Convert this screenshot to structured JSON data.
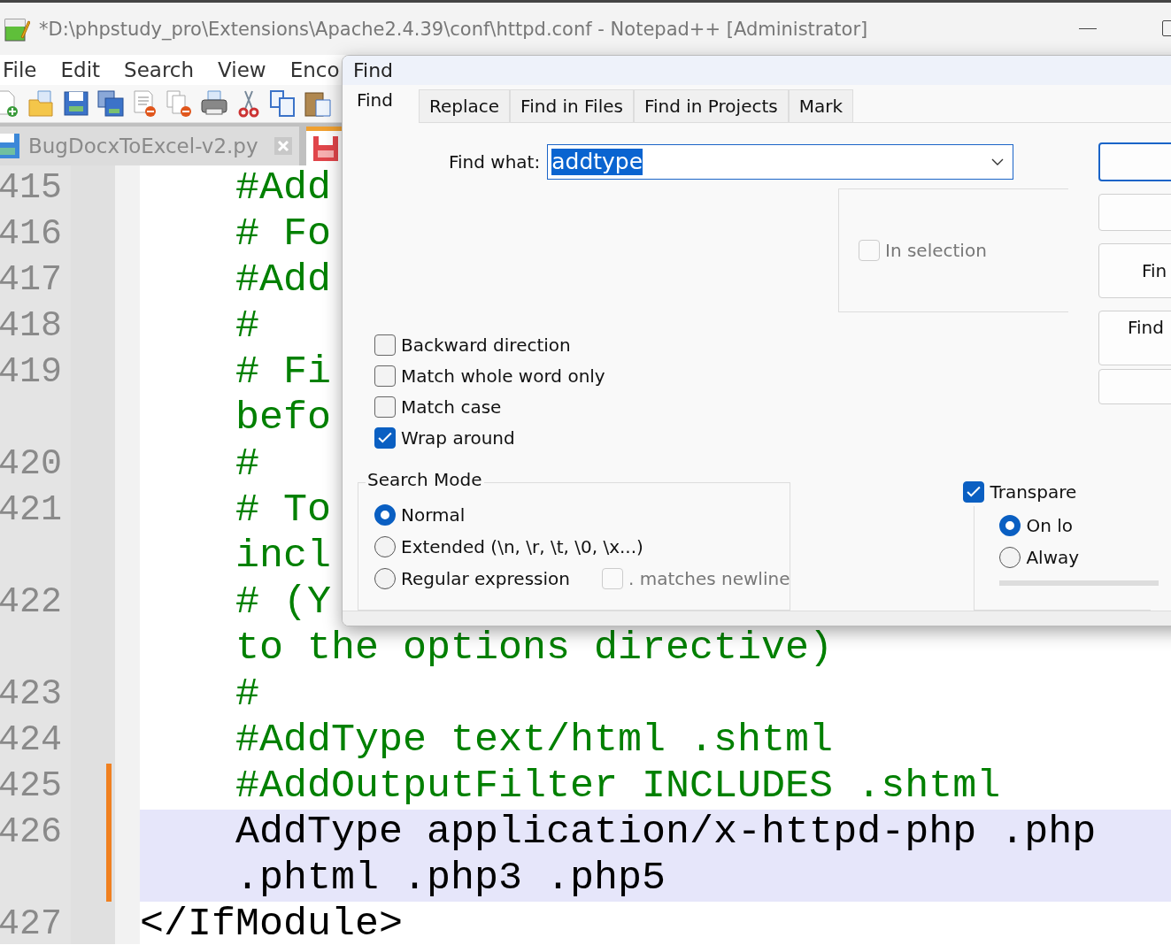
{
  "window": {
    "title": "*D:\\phpstudy_pro\\Extensions\\Apache2.4.39\\conf\\httpd.conf - Notepad++ [Administrator]"
  },
  "menu": [
    "File",
    "Edit",
    "Search",
    "View",
    "Enco"
  ],
  "toolbar": [
    {
      "kind": "new"
    },
    {
      "kind": "open"
    },
    {
      "kind": "save"
    },
    {
      "kind": "saveall"
    },
    {
      "kind": "close"
    },
    {
      "kind": "closeall"
    },
    {
      "kind": "print"
    },
    {
      "kind": "cut"
    },
    {
      "kind": "copy"
    },
    {
      "kind": "paste"
    }
  ],
  "file_tabs": [
    {
      "label": "BugDocxToExcel-v2.py",
      "selected": false,
      "modified": false
    },
    {
      "selected": true,
      "modified": true
    }
  ],
  "code_lines": [
    {
      "number": "415",
      "kind": "comment",
      "modified": false,
      "highlighted": false,
      "rows": [
        "    #Add"
      ]
    },
    {
      "number": "416",
      "kind": "comment",
      "modified": false,
      "highlighted": false,
      "rows": [
        "    # Fo"
      ]
    },
    {
      "number": "417",
      "kind": "comment",
      "modified": false,
      "highlighted": false,
      "rows": [
        "    #Add"
      ]
    },
    {
      "number": "418",
      "kind": "comment",
      "modified": false,
      "highlighted": false,
      "rows": [
        "    #"
      ]
    },
    {
      "number": "419",
      "kind": "comment",
      "modified": false,
      "highlighted": false,
      "rows": [
        "    # Fi",
        "    befo"
      ]
    },
    {
      "number": "420",
      "kind": "comment",
      "modified": false,
      "highlighted": false,
      "rows": [
        "    #"
      ]
    },
    {
      "number": "421",
      "kind": "comment",
      "modified": false,
      "highlighted": false,
      "rows": [
        "    # To",
        "    incl"
      ]
    },
    {
      "number": "422",
      "kind": "comment",
      "modified": false,
      "highlighted": false,
      "rows": [
        "    # (Y",
        "    to the options directive)"
      ]
    },
    {
      "number": "423",
      "kind": "comment",
      "modified": false,
      "highlighted": false,
      "rows": [
        "    #"
      ]
    },
    {
      "number": "424",
      "kind": "comment",
      "modified": false,
      "highlighted": false,
      "rows": [
        "    #AddType text/html .shtml"
      ]
    },
    {
      "number": "425",
      "kind": "comment",
      "modified": true,
      "highlighted": false,
      "rows": [
        "    #AddOutputFilter INCLUDES .shtml"
      ]
    },
    {
      "number": "426",
      "kind": "code",
      "modified": true,
      "highlighted": true,
      "rows": [
        "    AddType application/x-httpd-php .php",
        "    .phtml .php3 .php5"
      ]
    },
    {
      "number": "427",
      "kind": "code",
      "modified": false,
      "highlighted": false,
      "rows": [
        "</IfModule>"
      ]
    }
  ],
  "dialog": {
    "title": "Find",
    "tabs": [
      {
        "label": "Find",
        "selected": true
      },
      {
        "label": "Replace",
        "selected": false
      },
      {
        "label": "Find in Files",
        "selected": false
      },
      {
        "label": "Find in Projects",
        "selected": false
      },
      {
        "label": "Mark",
        "selected": false
      }
    ],
    "find_what": {
      "label": "Find what:",
      "value": "addtype"
    },
    "buttons": [
      {
        "focused": true
      },
      {
        "focused": false
      },
      {
        "label": "Fin",
        "focused": false
      },
      {
        "label": "Find",
        "focused": false
      },
      {
        "focused": false
      }
    ],
    "in_selection": {
      "label": "In selection",
      "checked": false,
      "disabled": true
    },
    "options": [
      {
        "label": "Backward direction",
        "checked": false
      },
      {
        "label": "Match whole word only",
        "checked": false
      },
      {
        "label": "Match case",
        "checked": false
      },
      {
        "label": "Wrap around",
        "checked": true
      }
    ],
    "search_mode": {
      "title": "Search Mode",
      "modes": [
        {
          "label": "Normal",
          "selected": true
        },
        {
          "label": "Extended (\\n, \\r, \\t, \\0, \\x...)",
          "selected": false
        },
        {
          "label": "Regular expression",
          "selected": false
        }
      ],
      "dot_matches_newline": {
        "label": ". matches newline",
        "checked": false,
        "disabled": true
      }
    },
    "transparency": {
      "label": "Transpare",
      "checked": true,
      "modes": [
        {
          "label": "On lo",
          "selected": true
        },
        {
          "label": "Alway",
          "selected": false
        }
      ]
    }
  }
}
